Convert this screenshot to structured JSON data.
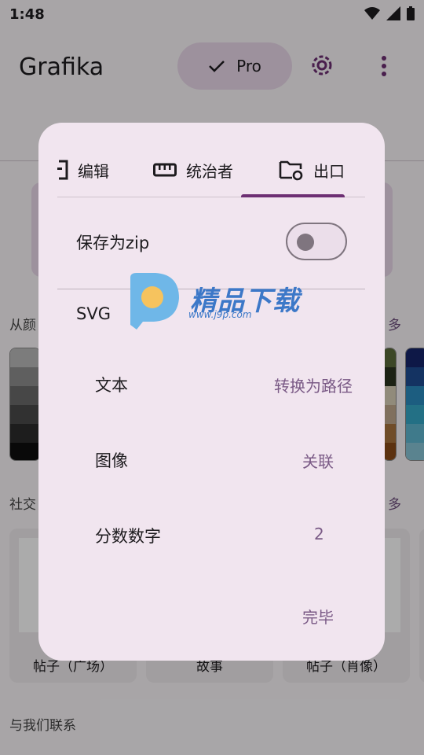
{
  "status": {
    "time": "1:48"
  },
  "app": {
    "title": "Grafika",
    "pro_label": "Pro"
  },
  "background": {
    "section_color_left": "从颜",
    "section_color_more": "多",
    "section_social_left": "社交",
    "section_social_more": "多",
    "tiles": [
      "帖子（广场）",
      "故事",
      "帖子（肖像）"
    ],
    "contact": "与我们联系"
  },
  "dialog": {
    "tabs": [
      {
        "label": "编辑",
        "icon": "edit-doc-icon"
      },
      {
        "label": "统治者",
        "icon": "ruler-icon"
      },
      {
        "label": "出口",
        "icon": "folder-settings-icon"
      }
    ],
    "active_tab": 2,
    "save_zip": {
      "label": "保存为zip",
      "enabled": false
    },
    "svg_label": "SVG",
    "rows": [
      {
        "label": "文本",
        "value": "转换为路径"
      },
      {
        "label": "图像",
        "value": "关联"
      },
      {
        "label": "分数数字",
        "value": "2"
      }
    ],
    "done_label": "完毕"
  },
  "watermark": {
    "text": "精品下载",
    "url": "www.j9p.com"
  },
  "colors": {
    "accent": "#6d2f73",
    "dialog_bg": "#f1e5ef",
    "value_text": "#7a5a86"
  }
}
